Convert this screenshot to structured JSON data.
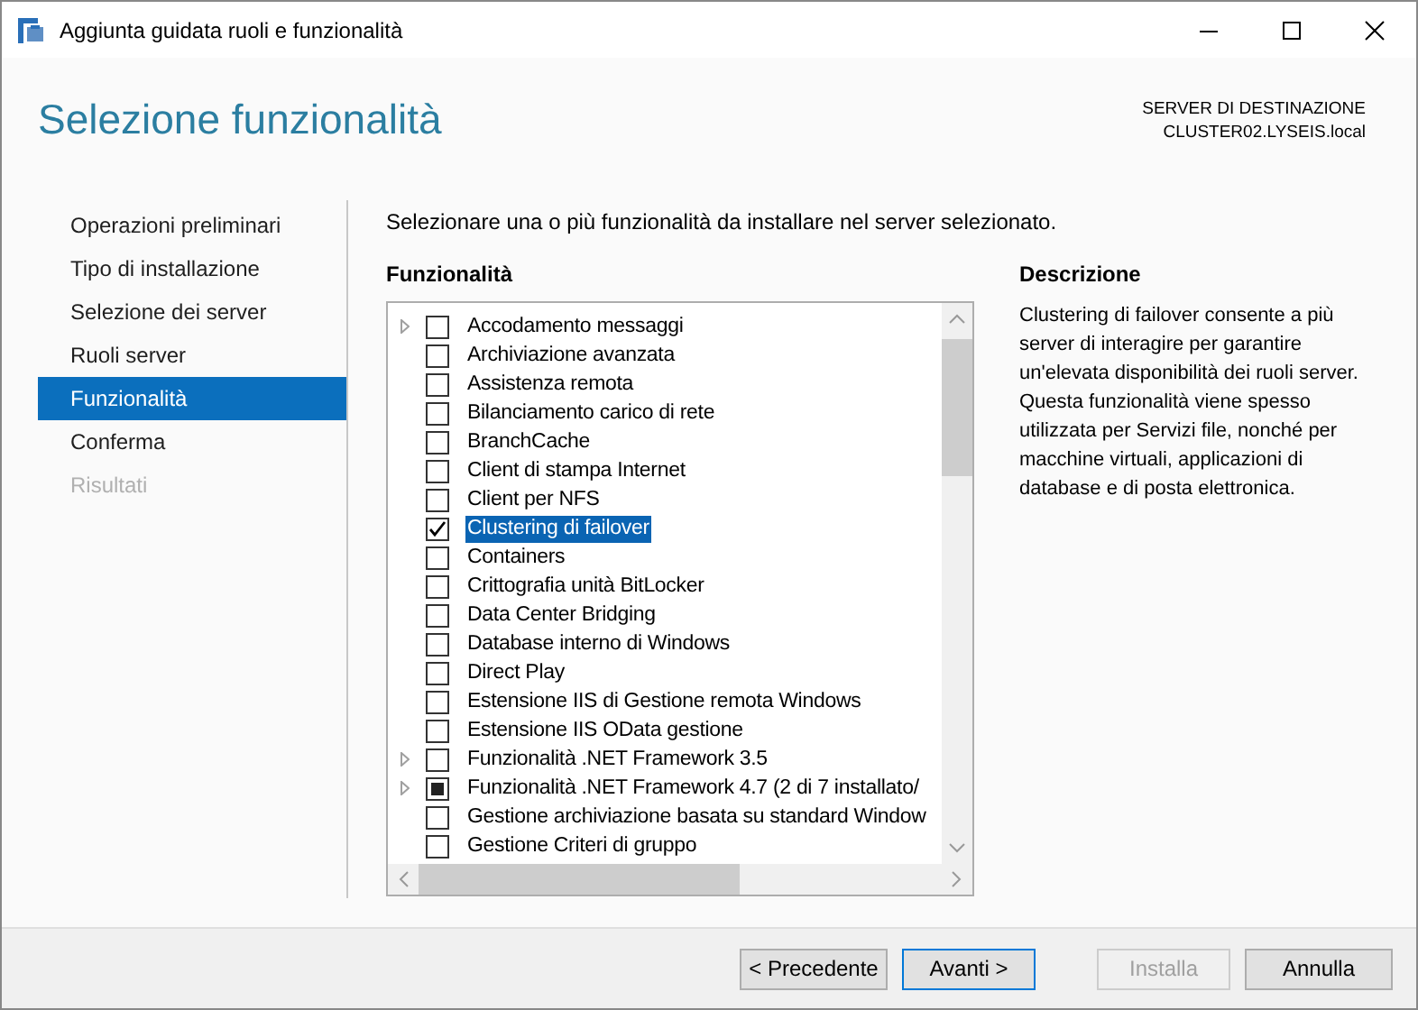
{
  "window": {
    "title": "Aggiunta guidata ruoli e funzionalità"
  },
  "header": {
    "title": "Selezione funzionalità",
    "server_label": "SERVER DI DESTINAZIONE",
    "server_name": "CLUSTER02.LYSEIS.local"
  },
  "sidebar": {
    "items": [
      {
        "label": "Operazioni preliminari",
        "selected": false,
        "disabled": false
      },
      {
        "label": "Tipo di installazione",
        "selected": false,
        "disabled": false
      },
      {
        "label": "Selezione dei server",
        "selected": false,
        "disabled": false
      },
      {
        "label": "Ruoli server",
        "selected": false,
        "disabled": false
      },
      {
        "label": "Funzionalità",
        "selected": true,
        "disabled": false
      },
      {
        "label": "Conferma",
        "selected": false,
        "disabled": false
      },
      {
        "label": "Risultati",
        "selected": false,
        "disabled": true
      }
    ]
  },
  "instruction": "Selezionare una o più funzionalità da installare nel server selezionato.",
  "features": {
    "heading": "Funzionalità",
    "items": [
      {
        "label": "Accodamento messaggi",
        "expandable": true,
        "checked": false,
        "indeterminate": false,
        "selected": false
      },
      {
        "label": "Archiviazione avanzata",
        "expandable": false,
        "checked": false,
        "indeterminate": false,
        "selected": false
      },
      {
        "label": "Assistenza remota",
        "expandable": false,
        "checked": false,
        "indeterminate": false,
        "selected": false
      },
      {
        "label": "Bilanciamento carico di rete",
        "expandable": false,
        "checked": false,
        "indeterminate": false,
        "selected": false
      },
      {
        "label": "BranchCache",
        "expandable": false,
        "checked": false,
        "indeterminate": false,
        "selected": false
      },
      {
        "label": "Client di stampa Internet",
        "expandable": false,
        "checked": false,
        "indeterminate": false,
        "selected": false
      },
      {
        "label": "Client per NFS",
        "expandable": false,
        "checked": false,
        "indeterminate": false,
        "selected": false
      },
      {
        "label": "Clustering di failover",
        "expandable": false,
        "checked": true,
        "indeterminate": false,
        "selected": true
      },
      {
        "label": "Containers",
        "expandable": false,
        "checked": false,
        "indeterminate": false,
        "selected": false
      },
      {
        "label": "Crittografia unità BitLocker",
        "expandable": false,
        "checked": false,
        "indeterminate": false,
        "selected": false
      },
      {
        "label": "Data Center Bridging",
        "expandable": false,
        "checked": false,
        "indeterminate": false,
        "selected": false
      },
      {
        "label": "Database interno di Windows",
        "expandable": false,
        "checked": false,
        "indeterminate": false,
        "selected": false
      },
      {
        "label": "Direct Play",
        "expandable": false,
        "checked": false,
        "indeterminate": false,
        "selected": false
      },
      {
        "label": "Estensione IIS di Gestione remota Windows",
        "expandable": false,
        "checked": false,
        "indeterminate": false,
        "selected": false
      },
      {
        "label": "Estensione IIS OData gestione",
        "expandable": false,
        "checked": false,
        "indeterminate": false,
        "selected": false
      },
      {
        "label": "Funzionalità .NET Framework 3.5",
        "expandable": true,
        "checked": false,
        "indeterminate": false,
        "selected": false
      },
      {
        "label": "Funzionalità .NET Framework 4.7 (2 di 7 installato/",
        "expandable": true,
        "checked": false,
        "indeterminate": true,
        "selected": false
      },
      {
        "label": "Gestione archiviazione basata su standard Window",
        "expandable": false,
        "checked": false,
        "indeterminate": false,
        "selected": false
      },
      {
        "label": "Gestione Criteri di gruppo",
        "expandable": false,
        "checked": false,
        "indeterminate": false,
        "selected": false
      }
    ]
  },
  "description": {
    "heading": "Descrizione",
    "text": "Clustering di failover consente a più server di interagire per garantire un'elevata disponibilità dei ruoli server. Questa funzionalità viene spesso utilizzata per Servizi file, nonché per macchine virtuali, applicazioni di database e di posta elettronica."
  },
  "buttons": [
    {
      "label": "< Precedente",
      "default": false,
      "disabled": false
    },
    {
      "label": "Avanti >",
      "default": true,
      "disabled": false
    },
    {
      "label": "Installa",
      "default": false,
      "disabled": true
    },
    {
      "label": "Annulla",
      "default": false,
      "disabled": false
    }
  ]
}
